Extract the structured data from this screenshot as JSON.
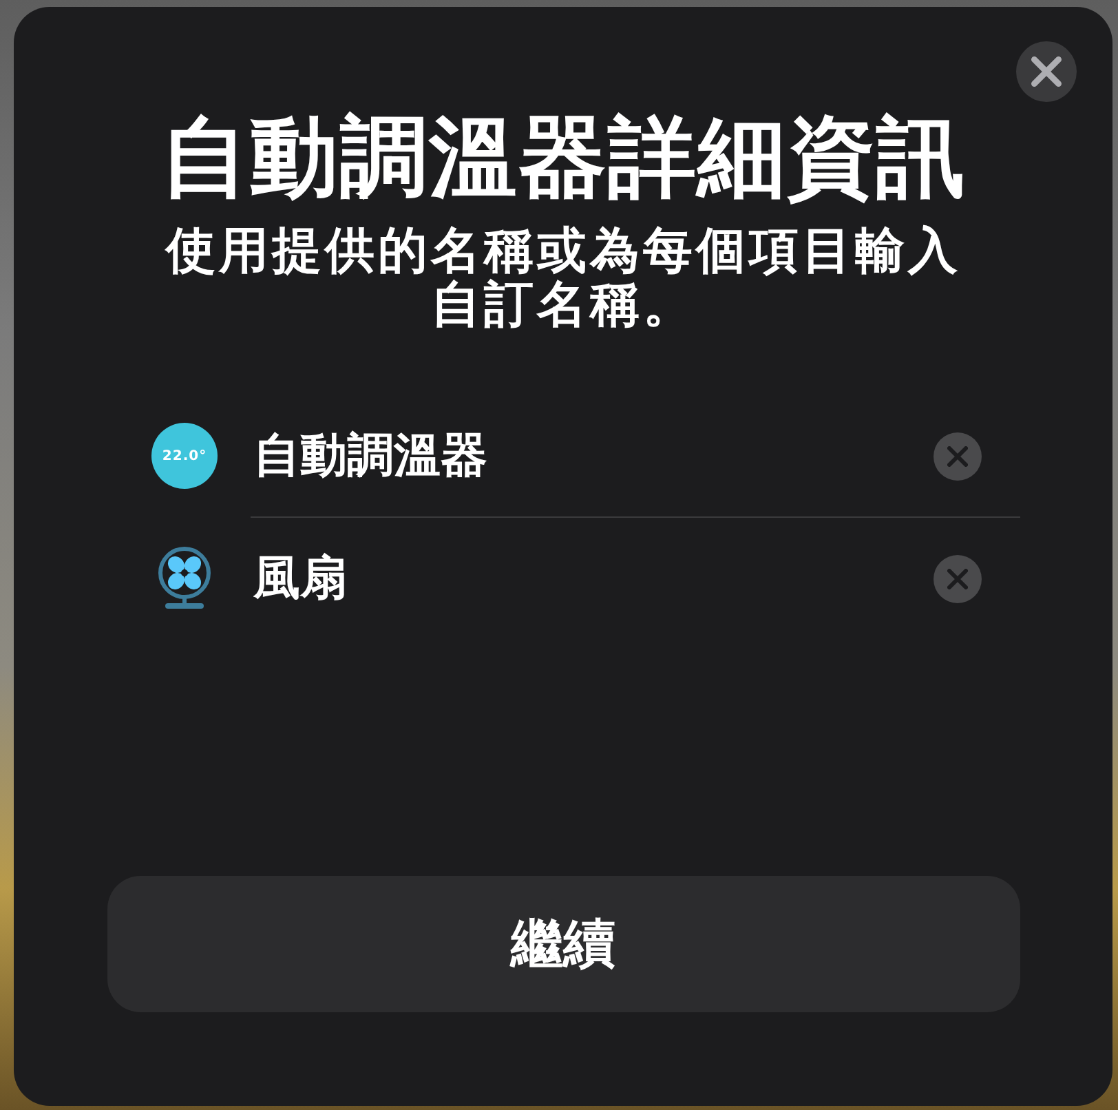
{
  "sheet": {
    "title": "自動調溫器詳細資訊",
    "subtitle": "使用提供的名稱或為每個項目輸入自訂名稱。"
  },
  "accessories": [
    {
      "kind": "thermostat",
      "reading": "22.0°",
      "name": "自動調溫器"
    },
    {
      "kind": "fan",
      "name": "風扇"
    }
  ],
  "continue_button": {
    "label": "繼續"
  }
}
